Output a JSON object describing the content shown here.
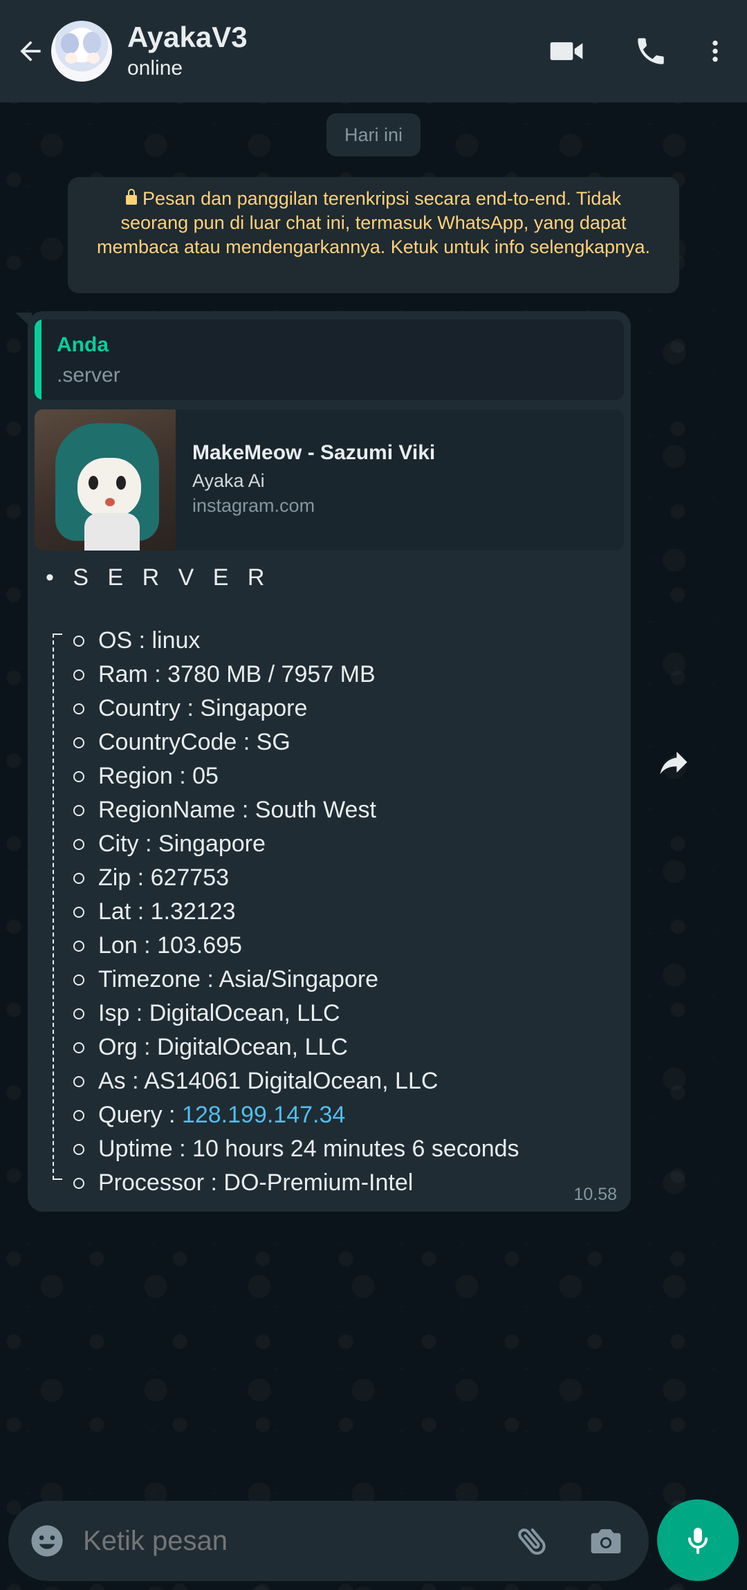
{
  "header": {
    "name": "AyakaV3",
    "status": "online"
  },
  "date_chip": "Hari ini",
  "encryption_notice": "Pesan dan panggilan terenkripsi secara end-to-end. Tidak seorang pun di luar chat ini, termasuk WhatsApp, yang dapat membaca atau mendengarkannya. Ketuk untuk info selengkapnya.",
  "message": {
    "quote": {
      "author": "Anda",
      "text": ".server"
    },
    "link_preview": {
      "title": "MakeMeow - Sazumi Viki",
      "description": "Ayaka Ai",
      "domain": "instagram.com"
    },
    "server_title": "• S E R V E R",
    "rows": [
      "OS : linux",
      "Ram : 3780 MB / 7957 MB",
      "Country : Singapore",
      "CountryCode : SG",
      "Region : 05",
      "RegionName : South West",
      "City : Singapore",
      "Zip : 627753",
      "Lat : 1.32123",
      "Lon : 103.695",
      "Timezone : Asia/Singapore",
      "Isp : DigitalOcean, LLC",
      "Org : DigitalOcean, LLC",
      "As : AS14061 DigitalOcean, LLC"
    ],
    "query_label": "Query : ",
    "query_value": "128.199.147.34",
    "uptime": "Uptime : 10 hours 24 minutes 6 seconds",
    "processor": "Processor : DO-Premium-Intel",
    "time": "10.58"
  },
  "input": {
    "placeholder": "Ketik pesan"
  },
  "colors": {
    "accent": "#00a884",
    "quote_author": "#06cf9c",
    "link": "#53bdeb",
    "notice_text": "#ffd279"
  },
  "icons": [
    "back-arrow-icon",
    "video-call-icon",
    "phone-icon",
    "more-vert-icon",
    "lock-icon",
    "forward-icon",
    "emoji-icon",
    "attach-icon",
    "camera-icon",
    "mic-icon"
  ]
}
